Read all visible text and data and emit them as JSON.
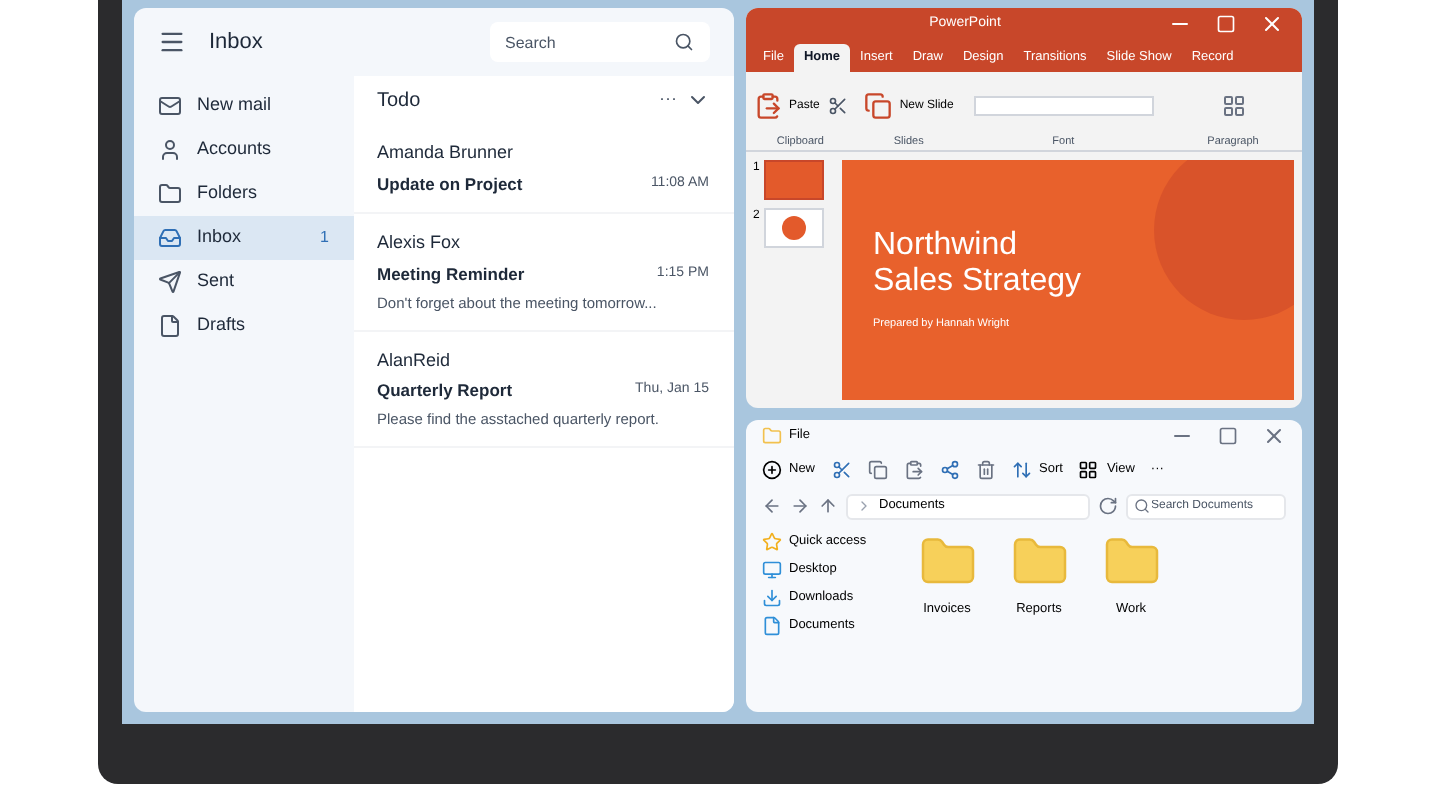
{
  "mail": {
    "title": "Inbox",
    "search": {
      "placeholder": "Search"
    },
    "nav": [
      {
        "label": "New mail",
        "selected": false
      },
      {
        "label": "Accounts",
        "selected": false
      },
      {
        "label": "Folders",
        "selected": false
      },
      {
        "label": "Inbox",
        "selected": true,
        "badge": "1"
      },
      {
        "label": "Sent",
        "selected": false
      },
      {
        "label": "Drafts",
        "selected": false
      }
    ],
    "list_title": "Todo",
    "more": "···",
    "messages": [
      {
        "sender": "Amanda Brunner",
        "subject": "Update on Project",
        "time": "11:08 AM"
      },
      {
        "sender": "Alexis Fox",
        "subject": "Meeting Reminder",
        "time": "1:15 PM",
        "preview": "Don't forget about the meeting tomorrow..."
      },
      {
        "sender": "AlanReid",
        "subject": "Quarterly Report",
        "time": "Thu, Jan 15",
        "preview": "Please find the asstached quarterly report."
      }
    ]
  },
  "slides_app": {
    "title": "PowerPoint",
    "tabs": [
      {
        "label": "File",
        "selected": false
      },
      {
        "label": "Home",
        "selected": true
      },
      {
        "label": "Insert",
        "selected": false
      },
      {
        "label": "Draw",
        "selected": false
      },
      {
        "label": "Design",
        "selected": false
      },
      {
        "label": "Transitions",
        "selected": false
      },
      {
        "label": "Slide Show",
        "selected": false
      },
      {
        "label": "Record",
        "selected": false
      }
    ],
    "buttons": [
      "Paste",
      "New Slide"
    ],
    "groups": [
      "Clipboard",
      "Slides",
      "Font",
      "Paragraph"
    ],
    "thumbnails": [
      {
        "number": "1",
        "kind": "rect",
        "selected": true
      },
      {
        "number": "2",
        "kind": "circle",
        "selected": false
      }
    ],
    "slide": {
      "title": "Northwind",
      "title_2": "Sales Strategy",
      "subtitle": "Prepared by Hannah Wright"
    }
  },
  "explorer": {
    "title": "File",
    "new": "New",
    "sort": "Sort",
    "view": "View",
    "more": "···",
    "address": "Documents",
    "search": {
      "placeholder": "Search Documents"
    },
    "sidebar": [
      {
        "label": "Quick access"
      },
      {
        "label": "Desktop"
      },
      {
        "label": "Downloads"
      },
      {
        "label": "Documents"
      }
    ],
    "folders": [
      "Invoices",
      "Reports",
      "Work"
    ]
  }
}
